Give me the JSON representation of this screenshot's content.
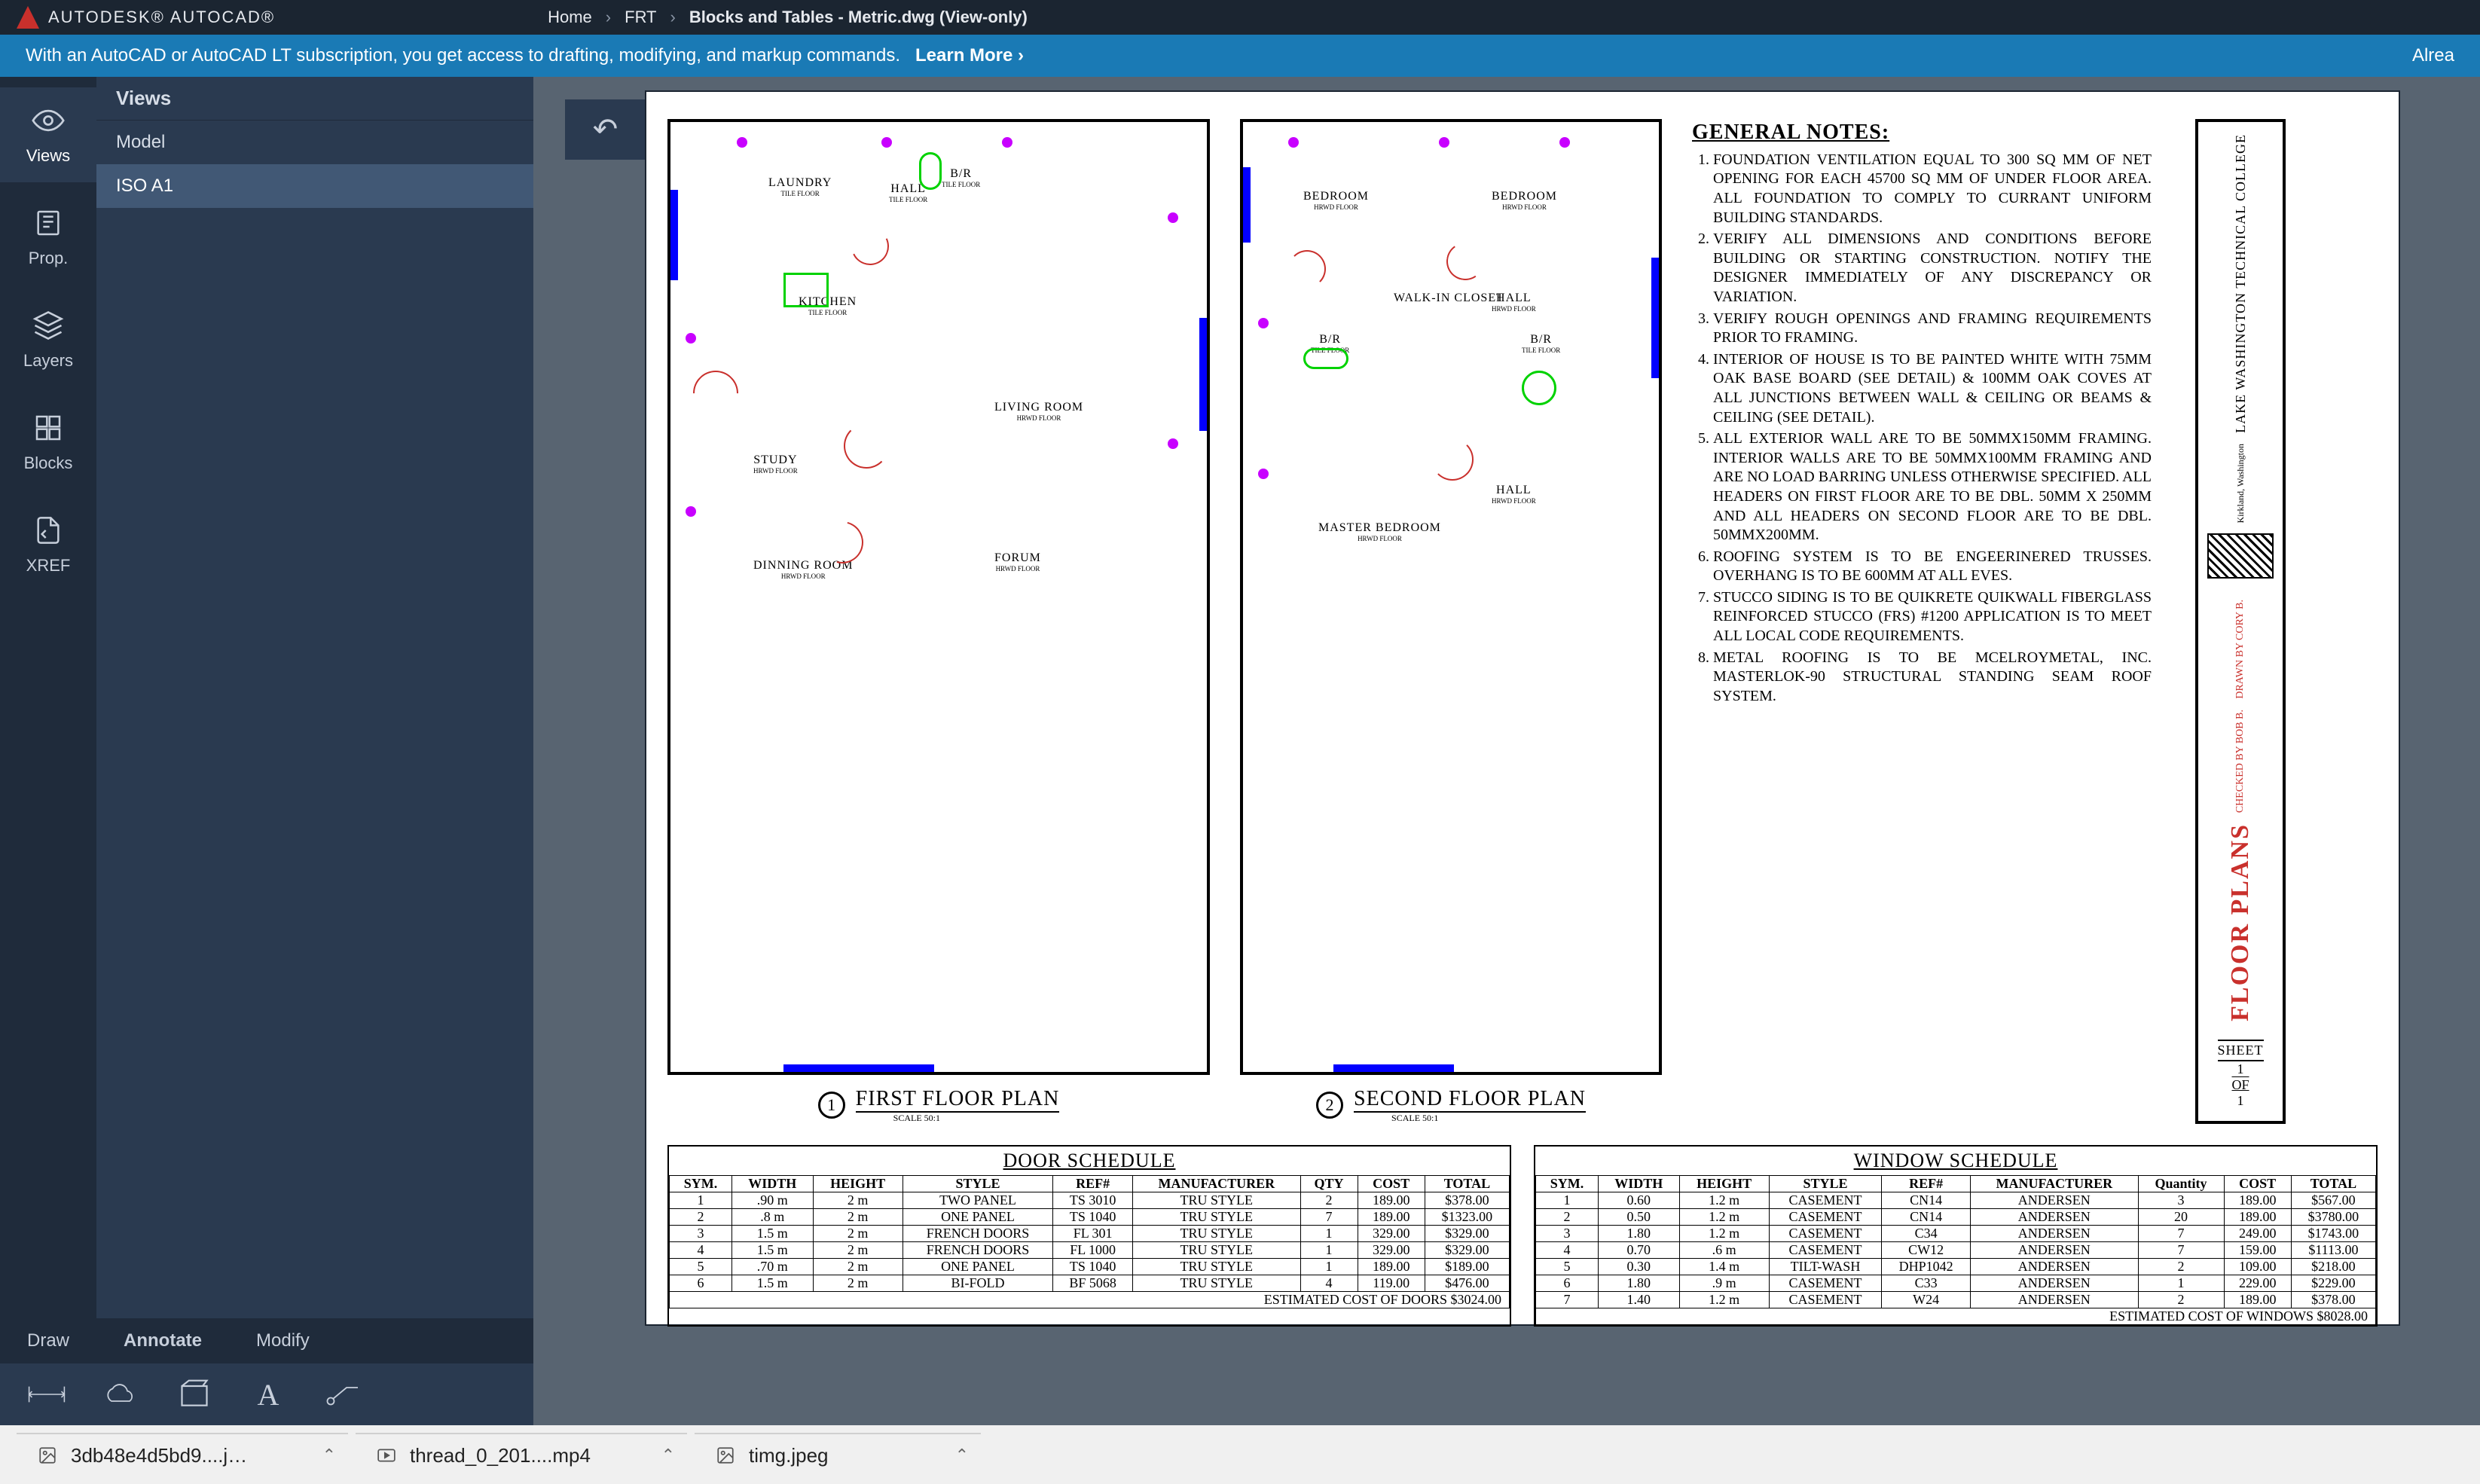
{
  "app": {
    "vendor_line1": "AUTODESK",
    "vendor_line2": "® AUTOCAD®"
  },
  "breadcrumb": {
    "home": "Home",
    "project": "FRT",
    "file": "Blocks and Tables - Metric.dwg (View-only)"
  },
  "banner": {
    "msg": "With an AutoCAD or AutoCAD LT subscription, you get access to drafting, modifying, and markup commands.",
    "learn": "Learn More",
    "right": "Alrea"
  },
  "rail": {
    "views": "Views",
    "prop": "Prop.",
    "layers": "Layers",
    "blocks": "Blocks",
    "xref": "XREF"
  },
  "views_panel": {
    "header": "Views",
    "items": [
      "Model",
      "ISO A1"
    ]
  },
  "bottom_tabs": {
    "draw": "Draw",
    "annotate": "Annotate",
    "modify": "Modify"
  },
  "drawing": {
    "plan1": {
      "num": "1",
      "title": "FIRST FLOOR PLAN",
      "scale": "SCALE  50:1",
      "rooms": [
        "LAUNDRY",
        "HALL",
        "B/R",
        "KITCHEN",
        "LIVING ROOM",
        "STUDY",
        "DINNING ROOM",
        "FORUM"
      ],
      "finish": [
        "TILE FLOOR",
        "TILE FLOOR",
        "TILE FLOOR",
        "TILE FLOOR",
        "HRWD FLOOR",
        "HRWD FLOOR",
        "HRWD FLOOR",
        "HRWD FLOOR"
      ]
    },
    "plan2": {
      "num": "2",
      "title": "SECOND FLOOR PLAN",
      "scale": "SCALE  50:1",
      "rooms": [
        "BEDROOM",
        "BEDROOM",
        "WALK-IN CLOSET",
        "HALL",
        "B/R",
        "B/R",
        "MASTER BEDROOM",
        "HALL"
      ],
      "finish": [
        "HRWD FLOOR",
        "HRWD FLOOR",
        "",
        "HRWD FLOOR",
        "TILE FLOOR",
        "TILE FLOOR",
        "HRWD FLOOR",
        "HRWD FLOOR"
      ]
    },
    "notes": {
      "heading": "GENERAL NOTES:",
      "items": [
        "FOUNDATION VENTILATION EQUAL TO 300 SQ MM OF NET OPENING FOR EACH 45700 SQ MM OF UNDER FLOOR AREA. ALL FOUNDATION TO COMPLY TO CURRANT UNIFORM BUILDING STANDARDS.",
        "VERIFY ALL DIMENSIONS AND CONDITIONS BEFORE BUILDING OR STARTING CONSTRUCTION. NOTIFY THE DESIGNER IMMEDIATELY OF ANY DISCREPANCY OR VARIATION.",
        "VERIFY ROUGH OPENINGS AND FRAMING REQUIREMENTS PRIOR TO FRAMING.",
        "INTERIOR OF HOUSE IS TO BE PAINTED WHITE WITH 75MM OAK BASE BOARD (SEE DETAIL) & 100MM OAK COVES AT ALL JUNCTIONS BETWEEN WALL & CEILING OR BEAMS & CEILING (SEE DETAIL).",
        "ALL EXTERIOR WALL ARE TO BE 50MMX150MM FRAMING. INTERIOR WALLS ARE TO BE 50MMX100MM FRAMING AND ARE NO LOAD BARRING UNLESS OTHERWISE SPECIFIED. ALL HEADERS ON FIRST FLOOR ARE TO BE DBL. 50MM X 250MM AND ALL HEADERS ON SECOND FLOOR ARE TO BE DBL. 50MMX200MM.",
        "ROOFING SYSTEM IS TO BE ENGEERINERED TRUSSES. OVERHANG IS TO BE 600MM AT ALL EVES.",
        "STUCCO SIDING IS TO BE QUIKRETE QUIKWALL FIBERGLASS REINFORCED STUCCO (FRS) #1200 APPLICATION IS TO MEET ALL LOCAL CODE REQUIREMENTS.",
        "METAL ROOFING IS TO BE MCELROYMETAL, INC. MASTERLOK-90 STRUCTURAL STANDING SEAM ROOF SYSTEM."
      ]
    },
    "title_block": {
      "org1": "LAKE WASHINGTON TECHNICAL COLLEGE",
      "org2": "Kirkland, Washington",
      "drawn": "CORY B.",
      "checked": "BOB B.",
      "sheet_main": "FLOOR PLANS",
      "sheet_label": "SHEET",
      "sheet_no": "1",
      "of": "OF",
      "sheet_tot": "1"
    }
  },
  "door_schedule": {
    "title": "DOOR SCHEDULE",
    "headers": [
      "SYM.",
      "WIDTH",
      "HEIGHT",
      "STYLE",
      "REF#",
      "MANUFACTURER",
      "QTY",
      "COST",
      "TOTAL"
    ],
    "rows": [
      [
        "1",
        ".90 m",
        "2 m",
        "TWO PANEL",
        "TS 3010",
        "TRU STYLE",
        "2",
        "189.00",
        "$378.00"
      ],
      [
        "2",
        ".8 m",
        "2 m",
        "ONE PANEL",
        "TS 1040",
        "TRU STYLE",
        "7",
        "189.00",
        "$1323.00"
      ],
      [
        "3",
        "1.5 m",
        "2 m",
        "FRENCH DOORS",
        "FL 301",
        "TRU STYLE",
        "1",
        "329.00",
        "$329.00"
      ],
      [
        "4",
        "1.5 m",
        "2 m",
        "FRENCH DOORS",
        "FL 1000",
        "TRU STYLE",
        "1",
        "329.00",
        "$329.00"
      ],
      [
        "5",
        ".70 m",
        "2 m",
        "ONE PANEL",
        "TS 1040",
        "TRU STYLE",
        "1",
        "189.00",
        "$189.00"
      ],
      [
        "6",
        "1.5 m",
        "2 m",
        "BI-FOLD",
        "BF 5068",
        "TRU STYLE",
        "4",
        "119.00",
        "$476.00"
      ]
    ],
    "foot": "ESTIMATED COST OF DOORS $3024.00"
  },
  "window_schedule": {
    "title": "WINDOW SCHEDULE",
    "headers": [
      "SYM.",
      "WIDTH",
      "HEIGHT",
      "STYLE",
      "REF#",
      "MANUFACTURER",
      "Quantity",
      "COST",
      "TOTAL"
    ],
    "rows": [
      [
        "1",
        "0.60",
        "1.2 m",
        "CASEMENT",
        "CN14",
        "ANDERSEN",
        "3",
        "189.00",
        "$567.00"
      ],
      [
        "2",
        "0.50",
        "1.2 m",
        "CASEMENT",
        "CN14",
        "ANDERSEN",
        "20",
        "189.00",
        "$3780.00"
      ],
      [
        "3",
        "1.80",
        "1.2 m",
        "CASEMENT",
        "C34",
        "ANDERSEN",
        "7",
        "249.00",
        "$1743.00"
      ],
      [
        "4",
        "0.70",
        ".6 m",
        "CASEMENT",
        "CW12",
        "ANDERSEN",
        "7",
        "159.00",
        "$1113.00"
      ],
      [
        "5",
        "0.30",
        "1.4 m",
        "TILT-WASH",
        "DHP1042",
        "ANDERSEN",
        "2",
        "109.00",
        "$218.00"
      ],
      [
        "6",
        "1.80",
        ".9 m",
        "CASEMENT",
        "C33",
        "ANDERSEN",
        "1",
        "229.00",
        "$229.00"
      ],
      [
        "7",
        "1.40",
        "1.2 m",
        "CASEMENT",
        "W24",
        "ANDERSEN",
        "2",
        "189.00",
        "$378.00"
      ]
    ],
    "foot": "ESTIMATED COST OF WINDOWS $8028.00"
  },
  "taskbar": {
    "items": [
      "3db48e4d5bd9....j…",
      "thread_0_201....mp4",
      "timg.jpeg"
    ]
  }
}
